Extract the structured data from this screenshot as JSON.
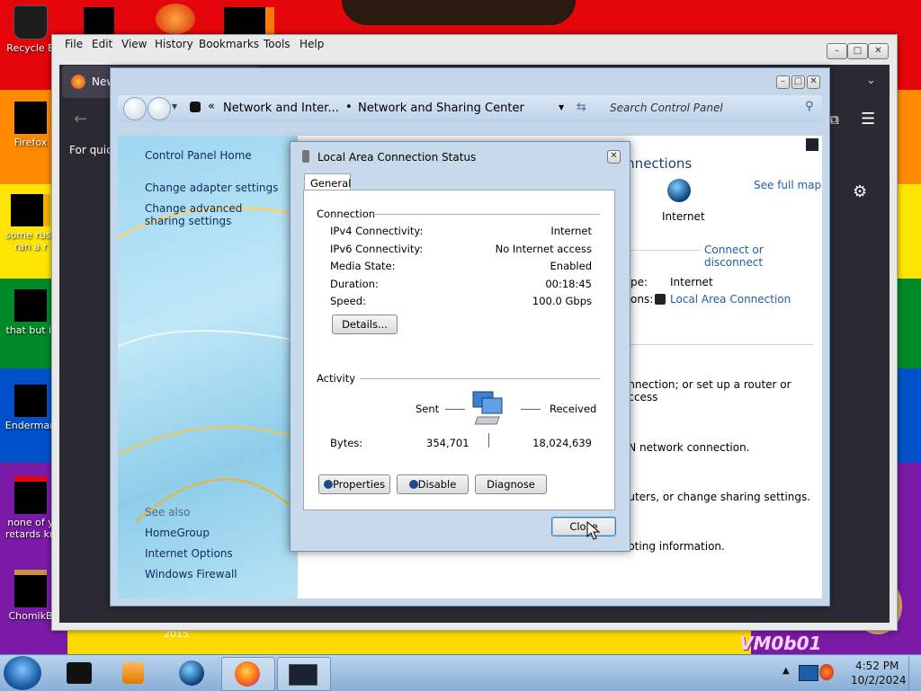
{
  "desktop": {
    "icons": [
      {
        "label": "Recycle B",
        "icon": "recycle-bin-icon"
      },
      {
        "label": "Firefox",
        "icon": "firefox-icon"
      },
      {
        "label": "some russ\nran a r",
        "icon": "image-file-icon"
      },
      {
        "label": "that but it",
        "icon": "image-file-icon"
      },
      {
        "label": "Enderman",
        "icon": "image-file-icon"
      },
      {
        "label": "none of y\nretards kn",
        "icon": "image-file-icon"
      },
      {
        "label": "ChomikB",
        "icon": "hamster-icon"
      }
    ],
    "wallpaper_text": "VM0b01",
    "year_text": "2015"
  },
  "firefox": {
    "menu": [
      "File",
      "Edit",
      "View",
      "History",
      "Bookmarks",
      "Tools",
      "Help"
    ],
    "tab_label": "New",
    "quick_text": "For quick"
  },
  "control_panel": {
    "breadcrumb": [
      "Network and Inter...",
      "Network and Sharing Center"
    ],
    "search_placeholder": "Search Control Panel",
    "left_links": [
      "Control Panel Home",
      "Change adapter settings",
      "Change advanced sharing settings"
    ],
    "see_also_title": "See also",
    "see_also": [
      "HomeGroup",
      "Internet Options",
      "Windows Firewall"
    ],
    "right": {
      "connections_text": "onnections",
      "see_full_map": "See full map",
      "internet_label": "Internet",
      "connect_disconnect": "Connect or disconnect",
      "access_type_label": "pe:",
      "access_type_value": "Internet",
      "connections_label": "ons:",
      "connections_value": "Local Area Connection",
      "line1": "onnection; or set up a router or access",
      "line2": "PN network connection.",
      "line3": "outers, or change sharing settings.",
      "line4": "ooting information."
    }
  },
  "dialog": {
    "title": "Local Area Connection Status",
    "tab": "General",
    "connection_header": "Connection",
    "rows": [
      {
        "label": "IPv4 Connectivity:",
        "value": "Internet"
      },
      {
        "label": "IPv6 Connectivity:",
        "value": "No Internet access"
      },
      {
        "label": "Media State:",
        "value": "Enabled"
      },
      {
        "label": "Duration:",
        "value": "00:18:45"
      },
      {
        "label": "Speed:",
        "value": "100.0 Gbps"
      }
    ],
    "details_button": "Details...",
    "activity_header": "Activity",
    "sent_label": "Sent",
    "received_label": "Received",
    "bytes_label": "Bytes:",
    "bytes_sent": "354,701",
    "bytes_received": "18,024,639",
    "properties_button": "Properties",
    "disable_button": "Disable",
    "diagnose_button": "Diagnose",
    "close_button": "Close"
  },
  "taskbar": {
    "time": "4:52 PM",
    "date": "10/2/2024"
  }
}
